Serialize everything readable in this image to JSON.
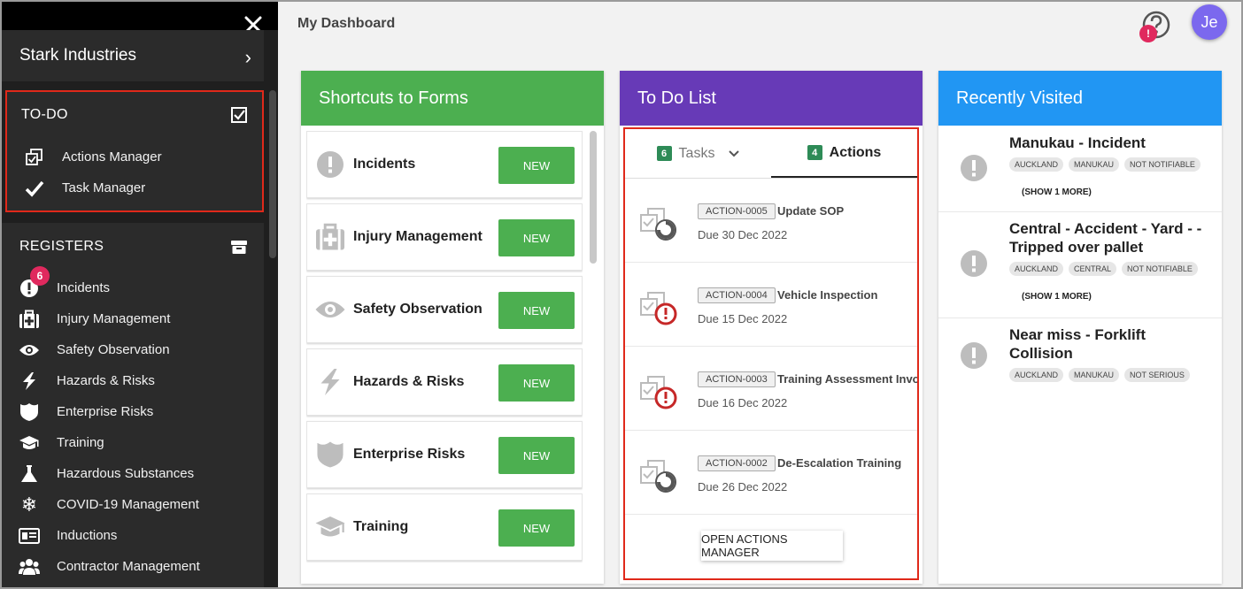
{
  "sidebar": {
    "org_name": "Stark Industries",
    "todo_heading": "TO-DO",
    "todo_items": [
      {
        "label": "Actions Manager",
        "icon": "actions-icon"
      },
      {
        "label": "Task Manager",
        "icon": "check-icon"
      }
    ],
    "registers_heading": "REGISTERS",
    "incidents_badge": "6",
    "register_items": [
      {
        "label": "Incidents",
        "icon": "alert-icon"
      },
      {
        "label": "Injury Management",
        "icon": "medical-kit-icon"
      },
      {
        "label": "Safety Observation",
        "icon": "eye-icon"
      },
      {
        "label": "Hazards & Risks",
        "icon": "lightning-icon"
      },
      {
        "label": "Enterprise Risks",
        "icon": "shield-icon"
      },
      {
        "label": "Training",
        "icon": "graduation-cap-icon"
      },
      {
        "label": "Hazardous Substances",
        "icon": "flask-icon"
      },
      {
        "label": "COVID-19 Management",
        "icon": "snowflake-icon"
      },
      {
        "label": "Inductions",
        "icon": "id-card-icon"
      },
      {
        "label": "Contractor Management",
        "icon": "group-icon"
      }
    ]
  },
  "header": {
    "title": "My Dashboard",
    "help_badge": "!",
    "avatar_initials": "Je"
  },
  "shortcuts": {
    "title": "Shortcuts to Forms",
    "color": "#4caf50",
    "new_label": "NEW",
    "items": [
      {
        "label": "Incidents",
        "icon": "alert-icon"
      },
      {
        "label": "Injury Management",
        "icon": "medical-kit-icon"
      },
      {
        "label": "Safety Observation",
        "icon": "eye-icon"
      },
      {
        "label": "Hazards & Risks",
        "icon": "lightning-icon"
      },
      {
        "label": "Enterprise Risks",
        "icon": "shield-icon"
      },
      {
        "label": "Training",
        "icon": "graduation-cap-icon"
      }
    ]
  },
  "todo": {
    "title": "To Do List",
    "color": "#673ab7",
    "tabs": [
      {
        "label": "Tasks",
        "count": "6"
      },
      {
        "label": "Actions",
        "count": "4"
      }
    ],
    "actions": [
      {
        "id": "ACTION-0005",
        "title": "Update SOP",
        "due": "Due 30 Dec 2022",
        "status": "pending"
      },
      {
        "id": "ACTION-0004",
        "title": "Vehicle Inspection",
        "due": "Due 15 Dec 2022",
        "status": "overdue"
      },
      {
        "id": "ACTION-0003",
        "title": "Training Assessment Involv",
        "due": "Due 16 Dec 2022",
        "status": "overdue"
      },
      {
        "id": "ACTION-0002",
        "title": "De-Escalation Training",
        "due": "Due 26 Dec 2022",
        "status": "pending"
      }
    ],
    "open_button": "OPEN ACTIONS MANAGER"
  },
  "recent": {
    "title": "Recently Visited",
    "color": "#2196f3",
    "items": [
      {
        "title": "Manukau - Incident",
        "tags": [
          "AUCKLAND",
          "MANUKAU",
          "NOT NOTIFIABLE"
        ],
        "show_more": "(SHOW 1 MORE)"
      },
      {
        "title": "Central - Accident - Yard - - Tripped over pallet",
        "tags": [
          "AUCKLAND",
          "CENTRAL",
          "NOT NOTIFIABLE"
        ],
        "show_more": "(SHOW 1 MORE)"
      },
      {
        "title": "Near miss - Forklift Collision",
        "tags": [
          "AUCKLAND",
          "MANUKAU",
          "NOT SERIOUS"
        ],
        "show_more": ""
      }
    ]
  }
}
